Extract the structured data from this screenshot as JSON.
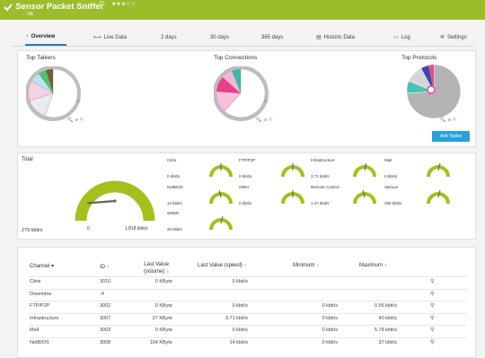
{
  "header": {
    "prefix": "Sensor",
    "name": "Packet Sniffer",
    "sup": "P1",
    "stars": "★★★☆☆",
    "status": "OK",
    "color": "#9cbc2c"
  },
  "tabs": [
    {
      "label": "Overview",
      "icon": "overview-icon"
    },
    {
      "label": "Live Data",
      "icon": "live-data-icon"
    },
    {
      "label": "2  days",
      "icon": ""
    },
    {
      "label": "30 days",
      "icon": ""
    },
    {
      "label": "365 days",
      "icon": ""
    },
    {
      "label": "Historic Data",
      "icon": "historic-data-icon"
    },
    {
      "label": "Log",
      "icon": "log-icon"
    },
    {
      "label": "Settings",
      "icon": "gear-icon"
    }
  ],
  "toplists": {
    "talkers_title": "Top Talkers",
    "connections_title": "Top Connections",
    "protocols_title": "Top Protocols",
    "add_button": "Add Toplist",
    "accent": "#27a2dc"
  },
  "gauges": {
    "total_label": "Total",
    "total_value": "279 kbit/s",
    "total_min": "0",
    "total_max": "1,818 kbit/s",
    "total_fraction": 0.15,
    "small": [
      {
        "label": "Citrix",
        "value": "0 kbit/s",
        "fraction": 0.5
      },
      {
        "label": "FTP/P2P",
        "value": "0 kbit/s",
        "fraction": 0.5
      },
      {
        "label": "Infrastructure",
        "value": "3.71 kbit/s",
        "fraction": 0.55
      },
      {
        "label": "Mail",
        "value": "0 kbit/s",
        "fraction": 0.55
      },
      {
        "label": "NetBIOS",
        "value": "14 kbit/s",
        "fraction": 0.45
      },
      {
        "label": "Other",
        "value": "0 kbit/s",
        "fraction": 0.5
      },
      {
        "label": "Remote Control",
        "value": "1.47 kbit/s",
        "fraction": 0.45
      },
      {
        "label": "Various",
        "value": "258 kbit/s",
        "fraction": 0.55
      },
      {
        "label": "WWW",
        "value": "26 kbit/s",
        "fraction": 0.55
      }
    ]
  },
  "table": {
    "headers": {
      "channel": "Channel",
      "id": "ID",
      "last_value": "Last Value",
      "last_value_sub": "(volume)",
      "last_speed": "Last Value (speed)",
      "minimum": "Minimum",
      "maximum": "Maximum"
    },
    "rows": [
      {
        "channel": "Citrix",
        "id": "3010",
        "volume": "0 KByte",
        "speed": "0 kbit/s",
        "min": "",
        "max": ""
      },
      {
        "channel": "Downtime",
        "id": "-4",
        "volume": "",
        "speed": "",
        "min": "",
        "max": ""
      },
      {
        "channel": "FTP/P2P",
        "id": "3002",
        "volume": "0 KByte",
        "speed": "0 kbit/s",
        "min": "0 kbit/s",
        "max": "0.56 kbit/s"
      },
      {
        "channel": "Infrastructure",
        "id": "3007",
        "volume": "27 KByte",
        "speed": "3.71 kbit/s",
        "min": "0 kbit/s",
        "max": "40 kbit/s"
      },
      {
        "channel": "Mail",
        "id": "3003",
        "volume": "0 KByte",
        "speed": "0 kbit/s",
        "min": "0 kbit/s",
        "max": "5.78 kbit/s"
      },
      {
        "channel": "NetBIOS",
        "id": "3008",
        "volume": "104 KByte",
        "speed": "14 kbit/s",
        "min": "0 kbit/s",
        "max": "37 kbit/s"
      }
    ]
  }
}
